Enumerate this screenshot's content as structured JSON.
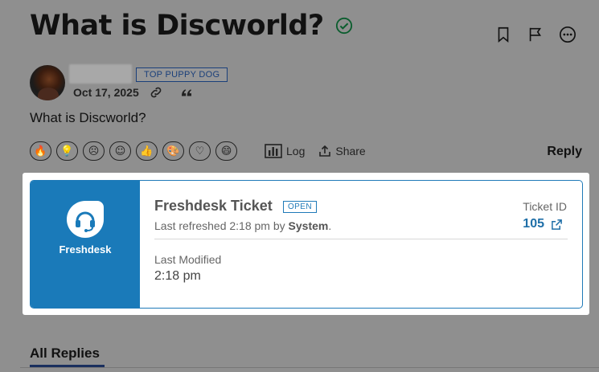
{
  "post": {
    "title": "What is Discworld?",
    "role_badge": "TOP PUPPY DOG",
    "date": "Oct 17, 2025",
    "body": "What is Discworld?"
  },
  "icons": {
    "verified": "check-circle-icon",
    "bookmark": "bookmark-icon",
    "flag": "flag-icon",
    "more": "more-horizontal-icon",
    "link": "link-icon",
    "quote": "quote-icon"
  },
  "reactions": [
    {
      "name": "fire-icon",
      "glyph": "🔥"
    },
    {
      "name": "lightbulb-icon",
      "glyph": "💡"
    },
    {
      "name": "frown-icon",
      "glyph": "☹"
    },
    {
      "name": "smile-icon",
      "glyph": "☺"
    },
    {
      "name": "thumbs-up-icon",
      "glyph": "👍"
    },
    {
      "name": "palette-icon",
      "glyph": "🎨"
    },
    {
      "name": "heart-icon",
      "glyph": "♡"
    },
    {
      "name": "laugh-icon",
      "glyph": "😄"
    }
  ],
  "actions": {
    "log_label": "Log",
    "share_label": "Share",
    "reply_label": "Reply"
  },
  "ticket_card": {
    "brand": "Freshdesk",
    "title": "Freshdesk Ticket",
    "status": "OPEN",
    "refresh_prefix": "Last refreshed 2:18 pm by ",
    "refresh_by": "System",
    "refresh_suffix": ".",
    "ticket_id_label": "Ticket ID",
    "ticket_id": "105",
    "modified_label": "Last Modified",
    "modified_value": "2:18 pm"
  },
  "replies": {
    "tab_label": "All Replies"
  },
  "colors": {
    "accent": "#1f7ab8",
    "freshdesk_blue": "#1a7ab9",
    "badge_navy": "#1a3f7a"
  }
}
